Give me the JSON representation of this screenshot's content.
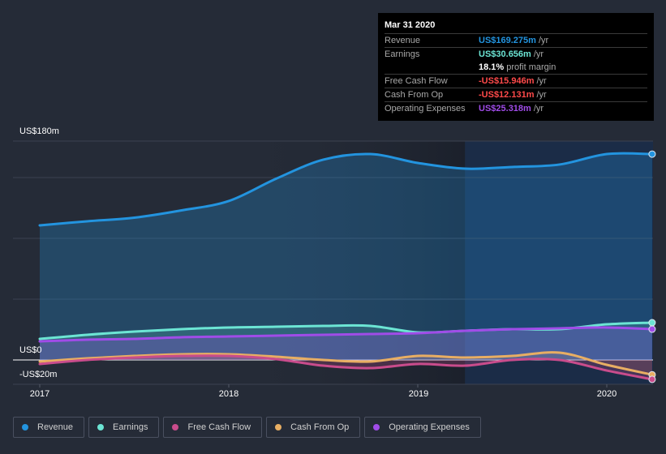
{
  "chart_data": {
    "type": "area",
    "title": "",
    "xlabel": "",
    "ylabel": "",
    "ylim": [
      -20,
      180
    ],
    "y_tick_labels": [
      "US$180m",
      "US$0",
      "-US$20m"
    ],
    "y_gridlines": [
      180,
      150,
      100,
      50,
      0,
      -20
    ],
    "x_tick_labels": [
      "2017",
      "2018",
      "2019",
      "2020"
    ],
    "x_ticks": [
      2017,
      2018,
      2019,
      2020
    ],
    "xlim": [
      2016.86,
      2020.25
    ],
    "highlight_start": 2019.25,
    "grid": true,
    "legend_position": "bottom-left",
    "x": [
      2017.0,
      2017.25,
      2017.5,
      2017.75,
      2018.0,
      2018.25,
      2018.5,
      2018.75,
      2019.0,
      2019.25,
      2019.5,
      2019.75,
      2020.0,
      2020.24
    ],
    "series": [
      {
        "name": "Revenue",
        "color": "#2394df",
        "values": [
          110.7,
          114,
          117,
          123,
          130.7,
          149,
          164.7,
          169.3,
          162,
          157.3,
          158.7,
          160.7,
          169.3,
          169.275
        ]
      },
      {
        "name": "Earnings",
        "color": "#6ce5d4",
        "values": [
          17.3,
          20.7,
          23.3,
          25.3,
          26.7,
          27.3,
          28,
          28,
          22.7,
          24,
          25.3,
          25.3,
          29.3,
          30.656
        ]
      },
      {
        "name": "Free Cash Flow",
        "color": "#c94c8c",
        "values": [
          -3.3,
          0,
          2,
          3.3,
          3.3,
          0.7,
          -4.7,
          -6.7,
          -3.3,
          -4.7,
          0,
          0,
          -8.7,
          -15.946
        ]
      },
      {
        "name": "Cash From Op",
        "color": "#e8ae63",
        "values": [
          -1.3,
          1.3,
          3.3,
          4.7,
          4.7,
          2.7,
          0,
          -1.3,
          3.3,
          2,
          3.3,
          6,
          -4,
          -12.131
        ]
      },
      {
        "name": "Operating Expenses",
        "color": "#a04ce8",
        "values": [
          15.3,
          16.7,
          17.3,
          18.7,
          19.3,
          20,
          20.7,
          21.3,
          22,
          24,
          25.3,
          26,
          26.7,
          25.318
        ]
      }
    ]
  },
  "tooltip": {
    "date": "Mar 31 2020",
    "rows": [
      {
        "label": "Revenue",
        "value": "US$169.275m",
        "unit": "/yr",
        "color": "#2394df"
      },
      {
        "label": "Earnings",
        "value": "US$30.656m",
        "unit": "/yr",
        "color": "#6ce5d4"
      },
      {
        "label": "",
        "value": "18.1%",
        "unit": "profit margin",
        "color": "#ffffff"
      },
      {
        "label": "Free Cash Flow",
        "value": "-US$15.946m",
        "unit": "/yr",
        "color": "#ff4a4a"
      },
      {
        "label": "Cash From Op",
        "value": "-US$12.131m",
        "unit": "/yr",
        "color": "#ff4a4a"
      },
      {
        "label": "Operating Expenses",
        "value": "US$25.318m",
        "unit": "/yr",
        "color": "#a04ce8"
      }
    ]
  },
  "legend": [
    {
      "label": "Revenue",
      "color": "#2394df"
    },
    {
      "label": "Earnings",
      "color": "#6ce5d4"
    },
    {
      "label": "Free Cash Flow",
      "color": "#c94c8c"
    },
    {
      "label": "Cash From Op",
      "color": "#e8ae63"
    },
    {
      "label": "Operating Expenses",
      "color": "#a04ce8"
    }
  ]
}
